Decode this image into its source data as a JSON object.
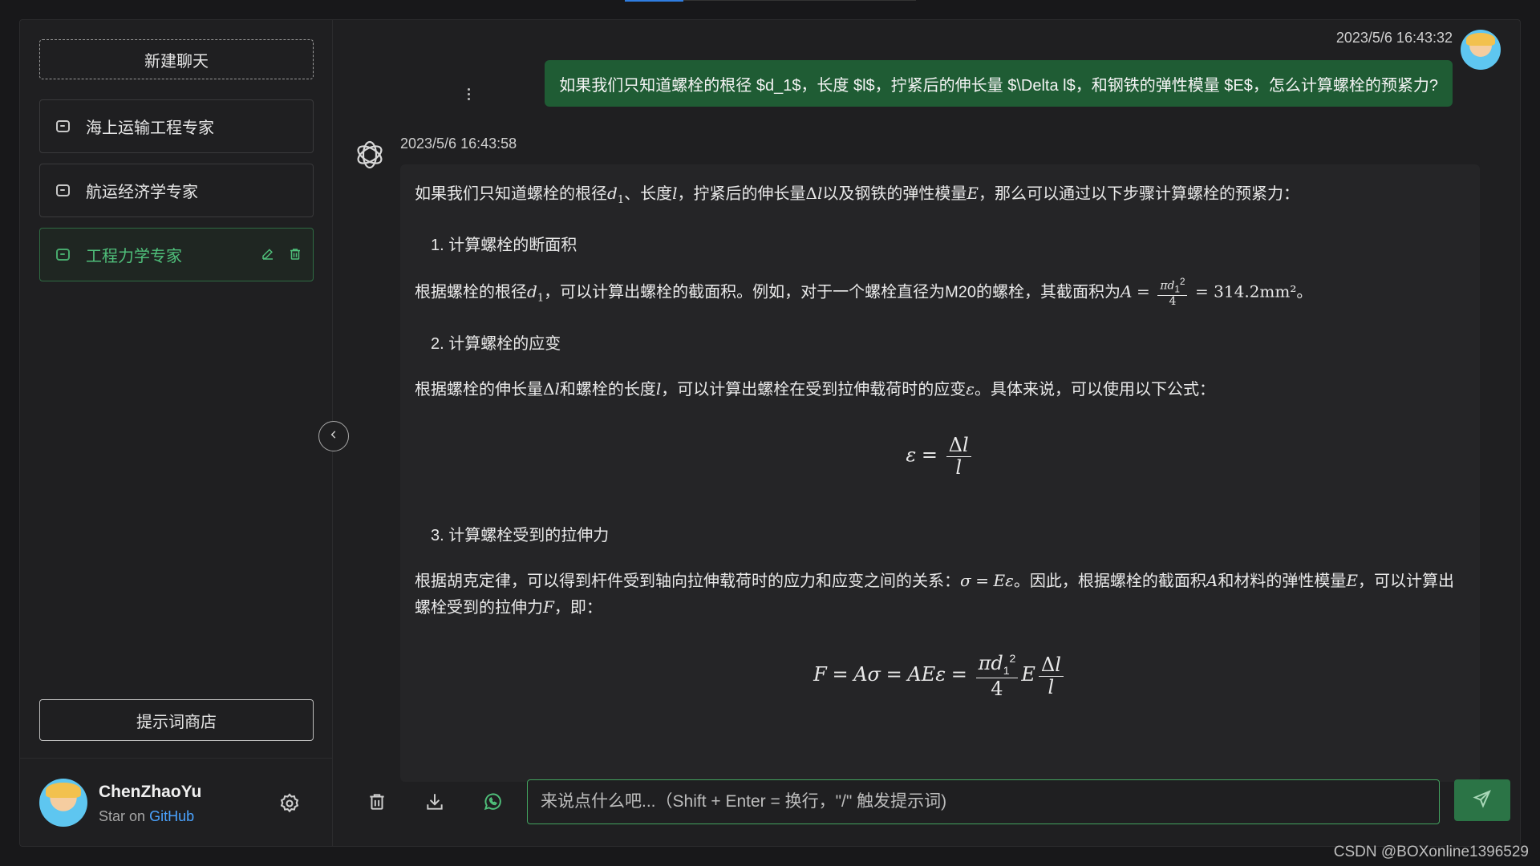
{
  "sidebar": {
    "new_chat_label": "新建聊天",
    "conversations": [
      {
        "title": "海上运输工程专家",
        "icon": "chat-icon",
        "active": false
      },
      {
        "title": "航运经济学专家",
        "icon": "chat-icon",
        "active": false
      },
      {
        "title": "工程力学专家",
        "icon": "chat-icon",
        "active": true
      }
    ],
    "prompt_store_label": "提示词商店",
    "user": {
      "name": "ChenZhaoYu",
      "star_text": "Star on",
      "github_link": "GitHub"
    }
  },
  "chat": {
    "user_message": {
      "timestamp": "2023/5/6 16:43:32",
      "text": "如果我们只知道螺栓的根径 $d_1$，长度 $l$，拧紧后的伸长量 $\\Delta l$，和钢铁的弹性模量 $E$，怎么计算螺栓的预紧力?"
    },
    "bot_message": {
      "timestamp": "2023/5/6 16:43:58",
      "intro_a": "如果我们只知道螺栓的根径",
      "intro_b": "、长度",
      "intro_c": "，拧紧后的伸长量",
      "intro_d": "以及钢铁的弹性模量",
      "intro_e": "，那么可以通过以下步骤计算螺栓的预紧力：",
      "step1": "1. 计算螺栓的断面积",
      "p1_a": "根据螺栓的根径",
      "p1_b": "，可以计算出螺栓的截面积。例如，对于一个螺栓直径为M20的螺栓，其截面积为",
      "p1_value": "= 314.2mm²",
      "p1_end": "。",
      "step2": "2. 计算螺栓的应变",
      "p2_a": "根据螺栓的伸长量",
      "p2_b": "和螺栓的长度",
      "p2_c": "，可以计算出螺栓在受到拉伸载荷时的应变",
      "p2_d": "。具体来说，可以使用以下公式：",
      "step3": "3. 计算螺栓受到的拉伸力",
      "p3_a": "根据胡克定律，可以得到杆件受到轴向拉伸载荷时的应力和应变之间的关系：",
      "p3_b": "。因此，根据螺栓的截面积",
      "p3_c": "和材料的弹性模量",
      "p3_d": "，可以计算出螺栓受到的拉伸力",
      "p3_e": "，即："
    }
  },
  "input": {
    "placeholder": "来说点什么吧...（Shift + Enter = 换行，\"/\" 触发提示词)"
  },
  "toolbar_icons": [
    "trash-icon",
    "download-icon",
    "whatsapp-icon",
    "send-icon"
  ],
  "watermark": "CSDN @BOXonline1396529",
  "colors": {
    "accent_green": "#2b7446",
    "user_bubble": "#1f5c34",
    "active_text": "#4fbf7a",
    "link_blue": "#4aa3ff"
  }
}
